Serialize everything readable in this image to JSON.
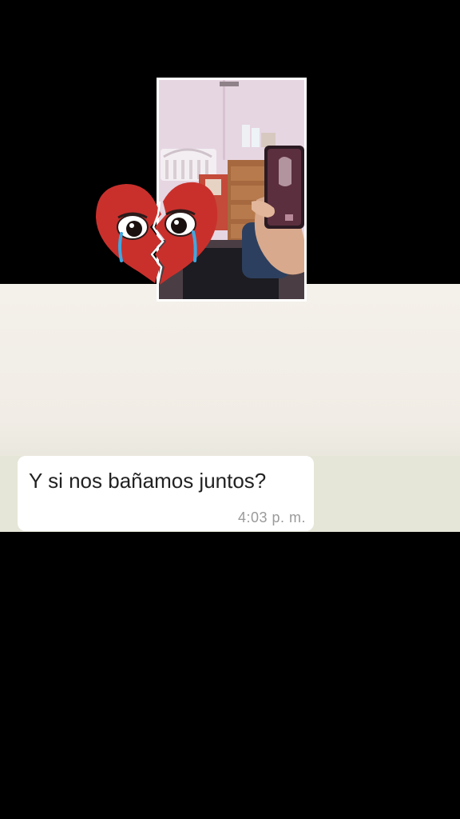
{
  "message": {
    "text": "Y si nos bañamos juntos?",
    "time": "4:03 p. m."
  },
  "colors": {
    "background": "#000000",
    "chat_wallpaper": "#f1ede6",
    "bubble": "#ffffff",
    "heart": "#c9302c"
  },
  "icons": {
    "sticker": "crying-broken-heart-icon"
  }
}
